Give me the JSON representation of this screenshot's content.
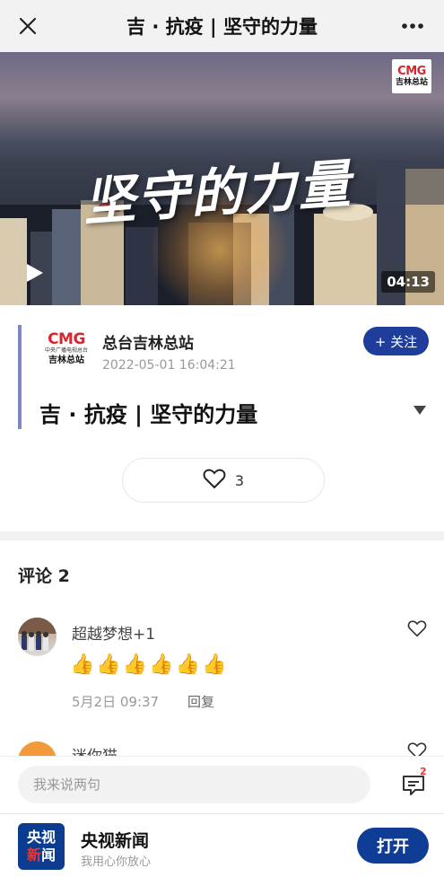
{
  "topbar": {
    "title": "吉 · 抗疫 | 坚守的力量"
  },
  "video": {
    "overlay_title": "坚守的力量",
    "logo_text": "CMG",
    "logo_sub": "吉林总站",
    "duration": "04:13"
  },
  "author": {
    "logo_text": "CMG",
    "logo_tiny": "中央广播电视总台",
    "logo_sub": "吉林总站",
    "name": "总台吉林总站",
    "timestamp": "2022-05-01 16:04:21",
    "follow_label": "+ 关注"
  },
  "article": {
    "title": "吉 · 抗疫 | 坚守的力量"
  },
  "likes": {
    "count": "3"
  },
  "comments": {
    "header": "评论 2",
    "items": [
      {
        "author": "超越梦想+1",
        "text": "👍👍👍👍👍👍",
        "time": "5月2日 09:37",
        "reply_label": "回复"
      },
      {
        "author": "迷你猫"
      }
    ]
  },
  "input": {
    "placeholder": "我来说两句",
    "comment_badge": "2"
  },
  "app_banner": {
    "logo_top": "央视",
    "logo_bottom_1": "新",
    "logo_bottom_2": "闻",
    "name": "央视新闻",
    "slogan": "我用心你放心",
    "open_label": "打开"
  },
  "colors": {
    "accent_blue": "#1f3e9c",
    "cmg_red": "#d8262e",
    "badge_red": "#ee3333"
  }
}
